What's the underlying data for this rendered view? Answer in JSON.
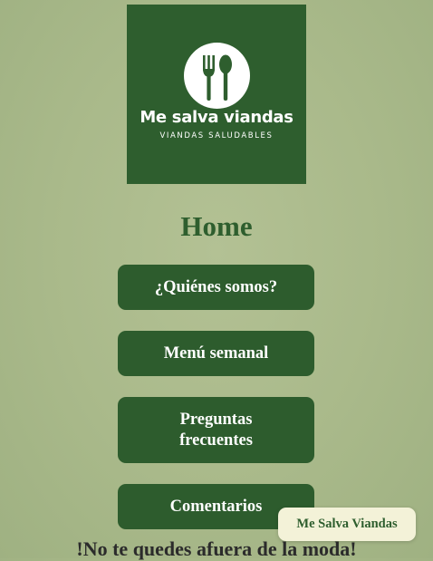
{
  "logo": {
    "title": "Me salva viandas",
    "subtitle": "VIANDAS SALUDABLES",
    "icon": "fork-spoon-icon",
    "background_color": "#2e5e2e"
  },
  "page_title": "Home",
  "nav": {
    "items": [
      {
        "label": "¿Quiénes somos?"
      },
      {
        "label": "Menú semanal"
      },
      {
        "label": "Preguntas frecuentes"
      },
      {
        "label": "Comentarios"
      }
    ]
  },
  "tagline": "!No te quedes afuera de la moda!",
  "floating_badge": {
    "label": "Me Salva Viandas"
  },
  "colors": {
    "accent": "#2d5c2d",
    "badge_background": "#f3f2d8",
    "page_background": "#aebd8f"
  }
}
